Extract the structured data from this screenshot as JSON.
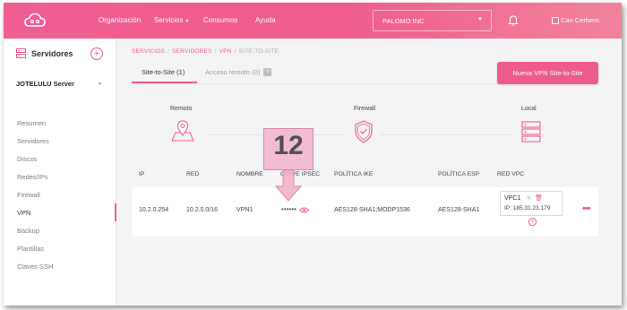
{
  "colors": {
    "brand": "#ee5a8c",
    "background": "#f4f4f6"
  },
  "topbar": {
    "nav": [
      {
        "label": "Organización"
      },
      {
        "label": "Servicios"
      },
      {
        "label": "Consumos"
      },
      {
        "label": "Ayuda"
      }
    ],
    "org_select": "PALOMO INC",
    "user_name": "Can Cerbero"
  },
  "sidebar": {
    "title": "Servidores",
    "server": "JOTELULU Server",
    "items": [
      {
        "label": "Resumen"
      },
      {
        "label": "Servidores"
      },
      {
        "label": "Discos"
      },
      {
        "label": "Redes/IPs"
      },
      {
        "label": "Firewall"
      },
      {
        "label": "VPN"
      },
      {
        "label": "Backup"
      },
      {
        "label": "Plantillas"
      },
      {
        "label": "Claves SSH"
      }
    ]
  },
  "breadcrumb": [
    "SERVICIOS",
    "SERVIDORES",
    "VPN",
    "SITE-TO-SITE"
  ],
  "tabs": [
    {
      "label": "Site-to-Site (1)"
    },
    {
      "label": "Acceso remoto (0)"
    }
  ],
  "help_label": "?",
  "new_button": "Nueva VPN Site-to-Site",
  "sections": {
    "remote": "Remoto",
    "firewall": "Firewall",
    "local": "Local"
  },
  "table": {
    "headers": [
      "IP",
      "RED",
      "NOMBRE",
      "CLAVE IPSEC",
      "POLÍTICA IKE",
      "POLÍTICA ESP",
      "RED VPC"
    ],
    "row": {
      "ip": "10.2.0.254",
      "red": "10.2.0.0/16",
      "nombre": "VPN1",
      "clave": "••••••",
      "ike": "AES128-SHA1;MODP1536",
      "esp": "AES128-SHA1",
      "vpc_name": "VPC1",
      "vpc_ip": "IP: 185.31.23.179"
    }
  },
  "callout_number": "12"
}
